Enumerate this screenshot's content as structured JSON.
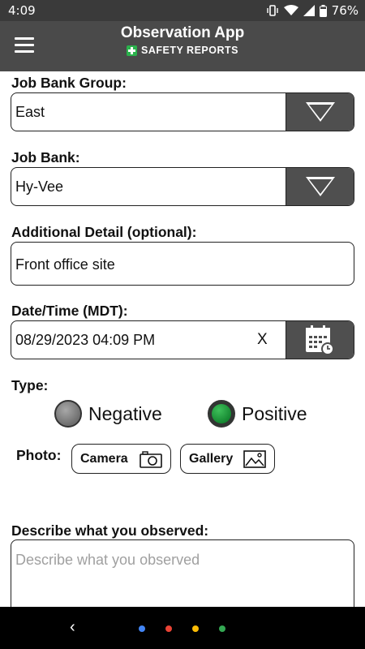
{
  "status_bar": {
    "time": "4:09",
    "battery": "76%",
    "icons": [
      "vibrate-icon",
      "wifi-icon",
      "signal-icon",
      "battery-icon"
    ]
  },
  "app_bar": {
    "title": "Observation App",
    "brand": "SAFETY REPORTS",
    "menu_icon": "hamburger-menu-icon"
  },
  "form": {
    "job_bank_group": {
      "label": "Job Bank Group:",
      "value": "East"
    },
    "job_bank": {
      "label": "Job Bank:",
      "value": "Hy-Vee"
    },
    "additional_detail": {
      "label": "Additional Detail (optional):",
      "value": "Front office site"
    },
    "datetime": {
      "label": "Date/Time (MDT):",
      "value": "08/29/2023 04:09 PM",
      "clear": "X"
    },
    "type": {
      "label": "Type:",
      "options": [
        {
          "label": "Negative",
          "selected": false
        },
        {
          "label": "Positive",
          "selected": true
        }
      ]
    },
    "photo": {
      "label": "Photo:",
      "camera": "Camera",
      "gallery": "Gallery"
    },
    "describe": {
      "label": "Describe what you observed:",
      "placeholder": "Describe what you observed"
    }
  },
  "nav_bar": {
    "back_glyph": "‹",
    "dots": [
      "#4285f4",
      "#ea4335",
      "#fbbc05",
      "#34a853"
    ]
  }
}
